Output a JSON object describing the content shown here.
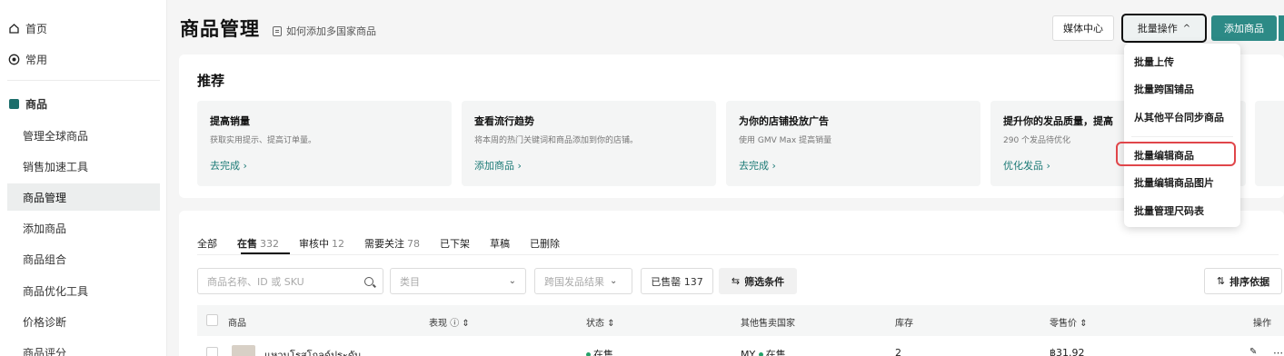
{
  "sidebar": {
    "items": [
      {
        "label": "首页",
        "icon": "home-icon"
      },
      {
        "label": "常用",
        "icon": "star-circle-icon"
      },
      {
        "label": "商品",
        "icon": "product-icon"
      },
      {
        "label": "管理全球商品"
      },
      {
        "label": "销售加速工具"
      },
      {
        "label": "商品管理",
        "active": true
      },
      {
        "label": "添加商品"
      },
      {
        "label": "商品组合"
      },
      {
        "label": "商品优化工具"
      },
      {
        "label": "价格诊断"
      },
      {
        "label": "商品评分"
      }
    ]
  },
  "header": {
    "title": "商品管理",
    "help_link": "如何添加多国家商品",
    "media_center": "媒体中心",
    "bulk_actions": "批量操作",
    "bulk_chevron": "^",
    "add_product": "添加商品"
  },
  "recommend": {
    "title": "推荐",
    "cards": [
      {
        "title": "提高销量",
        "desc": "获取实用提示、提高订单量。",
        "action": "去完成 ›"
      },
      {
        "title": "查看流行趋势",
        "desc": "将本周的热门关键词和商品添加到你的店铺。",
        "action": "添加商品 ›"
      },
      {
        "title": "为你的店铺投放广告",
        "desc": "使用 GMV Max 提高销量",
        "action": "去完成 ›"
      },
      {
        "title": "提升你的发品质量，提高",
        "desc": "290 个发品待优化",
        "action": "优化发品 ›"
      }
    ]
  },
  "tabs": [
    {
      "label": "全部",
      "count": ""
    },
    {
      "label": "在售",
      "count": "332",
      "active": true
    },
    {
      "label": "审核中",
      "count": "12"
    },
    {
      "label": "需要关注",
      "count": "78"
    },
    {
      "label": "已下架",
      "count": ""
    },
    {
      "label": "草稿",
      "count": ""
    },
    {
      "label": "已删除",
      "count": ""
    }
  ],
  "filters": {
    "search_placeholder": "商品名称、ID 或 SKU",
    "category_placeholder": "类目",
    "cross_border": "跨国发品结果",
    "sold_out": "已售罄 137",
    "more_filters": "筛选条件",
    "sort": "排序依据"
  },
  "table": {
    "headers": [
      "商品",
      "表现",
      "状态",
      "其他售卖国家",
      "库存",
      "零售价",
      "操作"
    ],
    "row": {
      "name": "แหวนโรสโกลด์ประดับ",
      "status": "在售",
      "countries": "MY",
      "country_status": "在售",
      "stock": "2",
      "price": "฿31.92"
    }
  },
  "dropdown": {
    "items": [
      "批量上传",
      "批量跨国铺品",
      "从其他平台同步商品",
      "批量编辑商品",
      "批量编辑商品图片",
      "批量管理尺码表"
    ],
    "highlighted": "批量编辑商品",
    "highlight_color": "#e0464a"
  },
  "colors": {
    "accent": "#2d8a86",
    "sidebar_active": "#eceeee",
    "status_green": "#26a16a"
  }
}
